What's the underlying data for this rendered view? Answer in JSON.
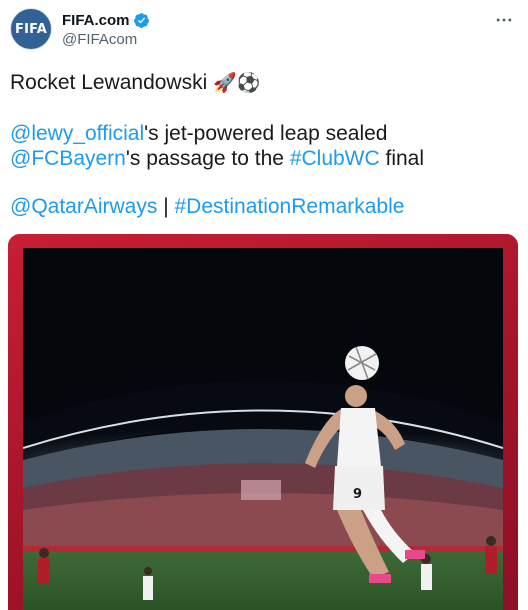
{
  "author": {
    "avatar_text": "FIFA",
    "display_name": "FIFA.com",
    "handle": "@FIFAcom",
    "verified": true
  },
  "menu_icon": "more-horizontal-icon",
  "tweet": {
    "line1_text": "Rocket Lewandowski ",
    "line1_emojis": "🚀⚽",
    "line2": {
      "mention1": "@lewy_official",
      "text1": "'s jet-powered leap sealed ",
      "mention2": "@FCBayern",
      "text2": "'s passage to the ",
      "hashtag": "#ClubWC",
      "text3": " final"
    },
    "line3": {
      "mention": "@QatarAirways",
      "separator": " | ",
      "hashtag": "#DestinationRemarkable"
    }
  },
  "media": {
    "jersey_number": "9"
  },
  "colors": {
    "link": "#1d9bf0",
    "frame": "#b2162a",
    "avatar": "#326295"
  }
}
